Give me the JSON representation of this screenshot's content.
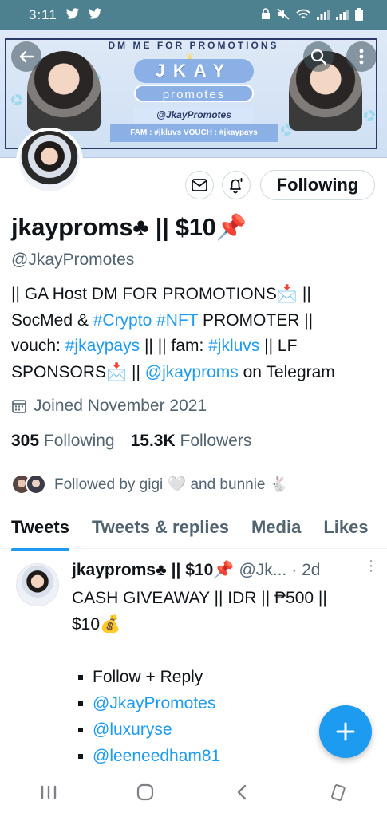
{
  "status_bar": {
    "time": "3:11",
    "icons": [
      "twitter-icon",
      "twitter-icon",
      "lock-icon",
      "mute-icon",
      "wifi-icon",
      "signal-icon",
      "signal-icon",
      "battery-icon"
    ]
  },
  "banner": {
    "top_text": "DM ME FOR PROMOTIONS",
    "brand_title": "JKAY",
    "brand_subtitle": "promotes",
    "handle_text": "@JkayPromotes",
    "tags_text": "FAM : #jkluvs   VOUCH : #jkaypays"
  },
  "profile": {
    "display_name": "jkayproms♣ || $10📌",
    "handle": "@JkayPromotes",
    "bio": {
      "line1": "|| GA Host DM FOR PROMOTIONS📩 ||",
      "line2_pre": "SocMed & ",
      "tag_crypto": "#Crypto",
      "tag_nft": "#NFT",
      "line2_post": " PROMOTER ||",
      "line3_pre": "vouch: ",
      "tag_vouch": "#jkaypays",
      "line3_mid": " || || fam: ",
      "tag_fam": "#jkluvs",
      "line3_post": " || LF",
      "line4_pre": "SPONSORS📩 || ",
      "mention": "@jkayproms",
      "line4_post": " on Telegram"
    },
    "joined": "Joined November 2021",
    "following_count": "305",
    "following_label": "Following",
    "followers_count": "15.3K",
    "followers_label": "Followers",
    "followed_by": "Followed by gigi 🤍 and bunnie 🐇"
  },
  "actions": {
    "following_button": "Following"
  },
  "tabs": [
    "Tweets",
    "Tweets & replies",
    "Media",
    "Likes"
  ],
  "tweet": {
    "author": "jkayproms♣ || $10📌",
    "handle": "@Jk...",
    "time": "· 2d",
    "line1": "CASH GIVEAWAY || IDR || ₱500 ||",
    "line2": "$10💰",
    "list": [
      "Follow + Reply",
      "@JkayPromotes",
      "@luxuryse",
      "@leeneedham81"
    ]
  },
  "colors": {
    "accent": "#1d9bf0",
    "status_bar": "#4d8190",
    "text_primary": "#0f1419",
    "text_secondary": "#536471"
  },
  "fab": {
    "icon": "plus-icon"
  }
}
